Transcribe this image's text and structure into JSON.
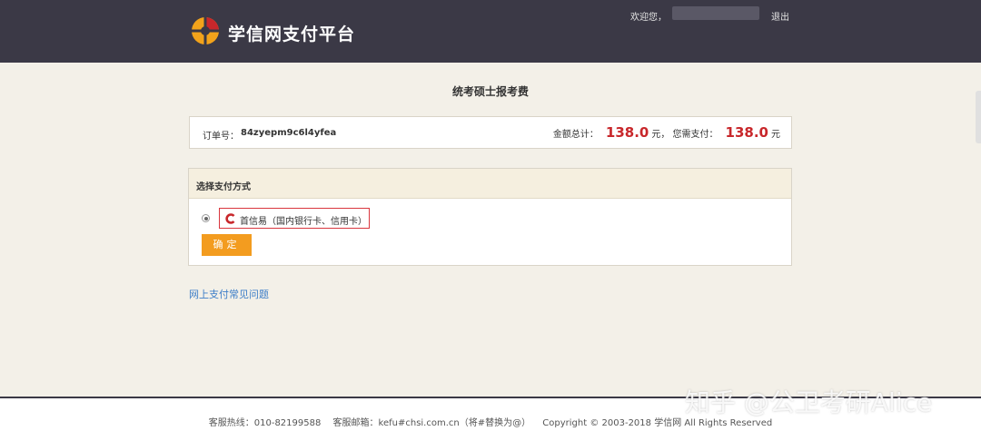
{
  "header": {
    "site_name": "学信网支付平台",
    "welcome": "欢迎您，",
    "logout": "退出"
  },
  "page_title": "统考硕士报考费",
  "order": {
    "order_label": "订单号：",
    "order_no": "84zyepm9c6l4yfea",
    "total_label": "金额总计：",
    "total_amount": "138.0",
    "currency1": "元，",
    "need_pay_label": "您需支付：",
    "need_pay_amount": "138.0",
    "currency2": "元"
  },
  "payment": {
    "section_title": "选择支付方式",
    "option_label": "首信易（国内银行卡、信用卡）",
    "confirm_label": "确定"
  },
  "faq_link": "网上支付常见问题",
  "footer": {
    "hotline": "客服热线：010-82199588",
    "email": "客服邮箱：kefu#chsi.com.cn（将#替换为@）",
    "copyright": "Copyright © 2003-2018 学信网 All Rights Reserved"
  },
  "watermark": "知乎 @公卫考研Alice",
  "colors": {
    "header_bg": "#3b3946",
    "accent_red": "#c8272b",
    "button_orange": "#f39c1f",
    "link_blue": "#3d7ec8"
  }
}
